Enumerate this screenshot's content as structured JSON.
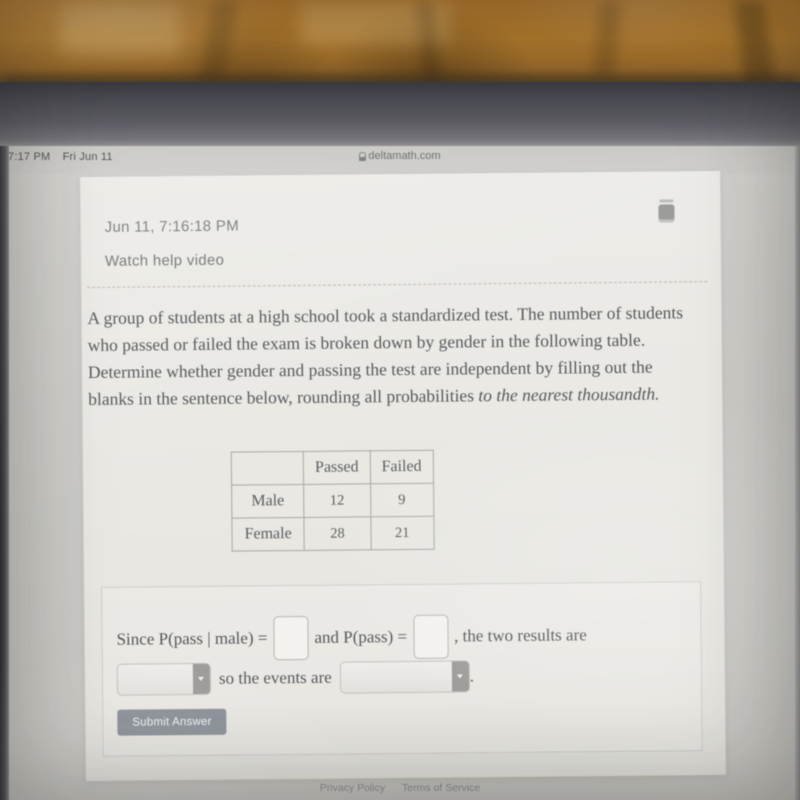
{
  "status_bar": {
    "time": "7:17 PM",
    "day_date": "Fri Jun 11",
    "url": "deltamath.com",
    "lock_icon": "lock-icon"
  },
  "content": {
    "timestamp": "Jun 11, 7:16:18 PM",
    "help_link": "Watch help video",
    "calculator_icon": "calculator-icon",
    "question": "A group of students at a high school took a standardized test. The number of students who passed or failed the exam is broken down by gender in the following table. Determine whether gender and passing the test are independent by filling out the blanks in the sentence below, rounding all probabilities ",
    "question_italic": "to the nearest thousandth.",
    "table": {
      "corner": "",
      "column_headers": [
        "Passed",
        "Failed"
      ],
      "rows": [
        {
          "label": "Male",
          "passed": "12",
          "failed": "9"
        },
        {
          "label": "Female",
          "passed": "28",
          "failed": "21"
        }
      ]
    },
    "answer": {
      "text_since": "Since P(pass | male) =",
      "input_1_value": "",
      "text_and": "and P(pass) =",
      "input_2_value": "",
      "text_results": ", the two results are",
      "dropdown_1_value": "",
      "text_so": "so the events are",
      "dropdown_2_value": "",
      "text_period": ".",
      "submit_label": "Submit Answer"
    }
  },
  "footer": {
    "privacy": "Privacy Policy",
    "terms": "Terms of Service"
  },
  "colors": {
    "submit_button": "#8d929a",
    "dropdown_arrow": "#9d9c99",
    "text": "#56575a",
    "fabric": "#b4792a"
  },
  "chart_data": {
    "type": "table",
    "title": "Passed / Failed by gender",
    "categories": [
      "Male",
      "Female"
    ],
    "columns": [
      "Passed",
      "Failed"
    ],
    "values": [
      [
        12,
        9
      ],
      [
        28,
        21
      ]
    ]
  }
}
